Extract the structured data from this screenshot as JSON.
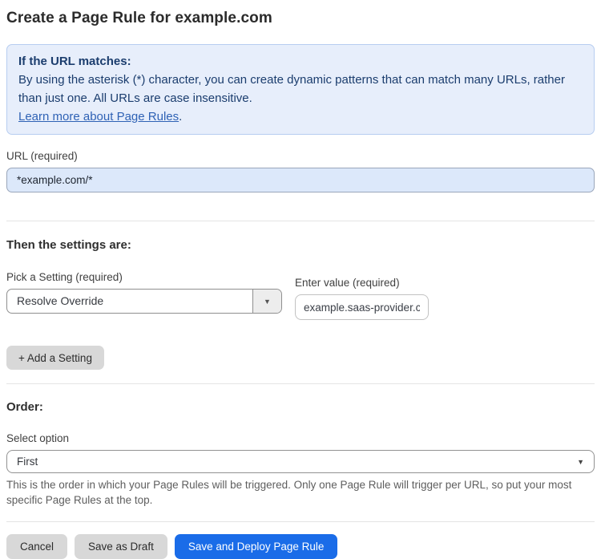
{
  "page": {
    "title": "Create a Page Rule for example.com"
  },
  "info_box": {
    "heading": "If the URL matches:",
    "body": "By using the asterisk (*) character, you can create dynamic patterns that can match many URLs, rather than just one. All URLs are case insensitive.",
    "link_label": "Learn more about Page Rules",
    "link_suffix": "."
  },
  "url_section": {
    "label": "URL (required)",
    "value": "*example.com/*"
  },
  "settings_section": {
    "heading": "Then the settings are:",
    "setting_label": "Pick a Setting (required)",
    "setting_selected": "Resolve Override",
    "value_label": "Enter value (required)",
    "value_value": "example.saas-provider.c",
    "add_button_label": "+ Add a Setting"
  },
  "order_section": {
    "heading": "Order:",
    "select_label": "Select option",
    "select_selected": "First",
    "help_text": "This is the order in which your Page Rules will be triggered. Only one Page Rule will trigger per URL, so put your most specific Page Rules at the top."
  },
  "actions": {
    "cancel_label": "Cancel",
    "save_draft_label": "Save as Draft",
    "deploy_label": "Save and Deploy Page Rule"
  },
  "icons": {
    "dropdown_arrow": "▼"
  },
  "colors": {
    "info_box_background": "#e7eefb",
    "info_box_border": "#b7cdf0",
    "info_box_text": "#1b3d6e",
    "link": "#2f62b5",
    "url_input_background": "#dce8fa",
    "primary_button": "#1a6ce8",
    "gray_button": "#d8d8d8"
  }
}
